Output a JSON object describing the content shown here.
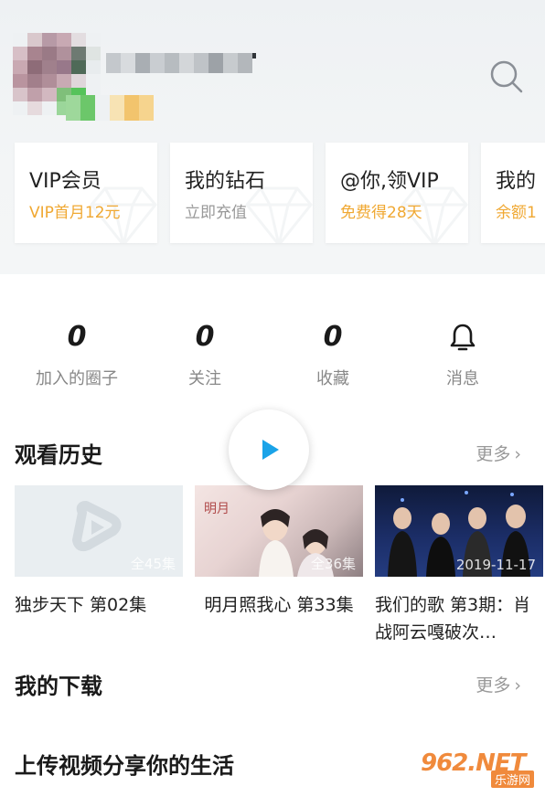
{
  "profile": {
    "avatar_icon": "pixelated-avatar",
    "search_icon": "search-icon"
  },
  "cards": [
    {
      "title": "VIP会员",
      "subtitle": "VIP首月12元",
      "sub_color": "#f0a832"
    },
    {
      "title": "我的钻石",
      "subtitle": "立即充值",
      "sub_color": "#999999"
    },
    {
      "title": "@你,领VIP",
      "subtitle": "免费得28天",
      "sub_color": "#f0a832"
    },
    {
      "title": "我的",
      "subtitle": "余额1",
      "sub_color": "#f0a832"
    }
  ],
  "stats": [
    {
      "value": "0",
      "label": "加入的圈子"
    },
    {
      "value": "0",
      "label": "关注"
    },
    {
      "value": "0",
      "label": "收藏"
    },
    {
      "icon": "bell-icon",
      "label": "消息"
    }
  ],
  "history": {
    "title": "观看历史",
    "more": "更多",
    "items": [
      {
        "title": "独步天下 第02集",
        "badge": "全45集"
      },
      {
        "title": "明月照我心 第33集",
        "badge": "全36集"
      },
      {
        "title": "我们的歌 第3期：肖战阿云嘎破次…",
        "badge": "2019-11-17"
      }
    ]
  },
  "downloads": {
    "title": "我的下载",
    "more": "更多"
  },
  "upload": {
    "title": "上传视频分享你的生活"
  },
  "watermark": {
    "brand": "962.NET",
    "sub": "乐游网"
  },
  "colors": {
    "accent": "#1aa3e8",
    "gold": "#f0a832",
    "header_bg": "#eef1f3"
  }
}
